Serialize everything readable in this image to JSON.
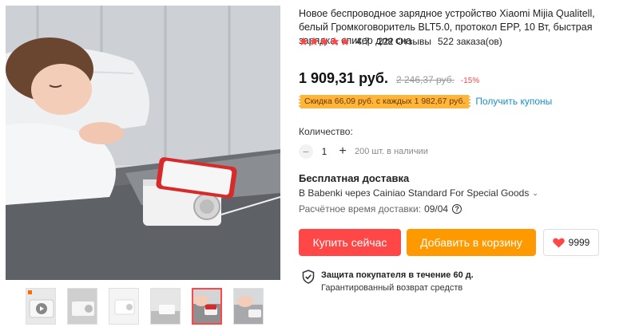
{
  "product": {
    "title": "Новое беспроводное зарядное устройство Xiaomi Mijia Qualitell, белый Громкоговоритель BLT5.0, протокол EPP, 10 Вт, быстрая зарядка, спикер для сна",
    "rating_value": "4.7",
    "reviews": "222 Отзывы",
    "orders": "522 заказа(ов)",
    "rating_stars": 5,
    "star_color": "#ff4747"
  },
  "price": {
    "current": "1 909,31 руб.",
    "old": "2 246,37 руб.",
    "discount": "-15%"
  },
  "coupon": {
    "tag": "Скидка 66,09 руб. с каждых 1 982,67 руб.",
    "link": "Получить купоны"
  },
  "quantity": {
    "label": "Количество:",
    "minus": "−",
    "value": "1",
    "plus": "+",
    "stock": "200 шт. в наличии"
  },
  "shipping": {
    "title": "Бесплатная доставка",
    "route": "В Babenki через Cainiao Standard For Special Goods",
    "time_label": "Расчётное время доставки:",
    "time_value": "09/04",
    "help": "?"
  },
  "actions": {
    "buy": "Купить сейчас",
    "cart": "Добавить в корзину",
    "wishlist_count": "9999"
  },
  "protection": {
    "title": "Защита покупателя в течение 60 д.",
    "subtitle": "Гарантированный возврат средств"
  },
  "colors": {
    "accent_red": "#ff4747",
    "accent_orange": "#ff9900",
    "coupon_bg": "#ffb43a",
    "link_blue": "#1a8fc7"
  },
  "gallery": {
    "selected_thumb": 5,
    "thumb_count": 6
  }
}
